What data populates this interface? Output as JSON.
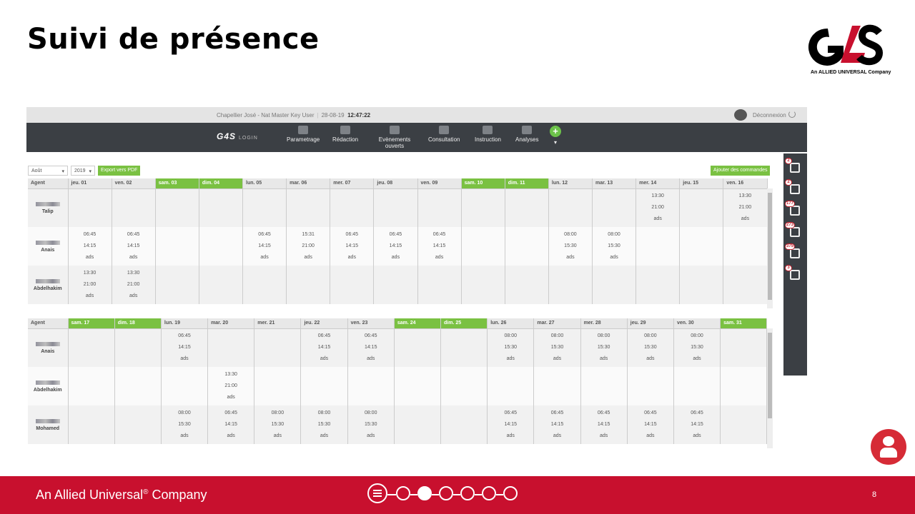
{
  "slide": {
    "title": "Suivi de présence",
    "page_number": "8"
  },
  "logo": {
    "text": "G4S",
    "tagline": "An ALLIED UNIVERSAL Company"
  },
  "app": {
    "topbar": {
      "user": "Chapellier José - Nat Master Key User",
      "date": "28-08-19",
      "time": "12:47:22",
      "logout": "Déconnexion"
    },
    "brand": {
      "mark": "G4S",
      "label": "LOGIN"
    },
    "nav": [
      {
        "label": "Parametrage",
        "icon": "gear-icon"
      },
      {
        "label": "Rédaction",
        "icon": "pencil-icon"
      },
      {
        "label": "Evènements ouverts",
        "icon": "clipboard-icon"
      },
      {
        "label": "Consultation",
        "icon": "book-icon"
      },
      {
        "label": "Instruction",
        "icon": "hierarchy-icon"
      },
      {
        "label": "Analyses",
        "icon": "bar-chart-icon"
      }
    ],
    "controls": {
      "month": "Août",
      "year": "2019",
      "export": "Export vers PDF",
      "add": "Ajouter des commandes"
    },
    "table1": {
      "headers": [
        "Agent",
        "jeu. 01",
        "ven. 02",
        "sam. 03",
        "dim. 04",
        "lun. 05",
        "mar. 06",
        "mer. 07",
        "jeu. 08",
        "ven. 09",
        "sam. 10",
        "dim. 11",
        "lun. 12",
        "mar. 13",
        "mer. 14",
        "jeu. 15",
        "ven. 16"
      ],
      "rows": [
        {
          "agent": "Talip",
          "cells": {
            "14": [
              "13:30",
              "21:00",
              "ads"
            ],
            "16": [
              "13:30",
              "21:00",
              "ads"
            ]
          }
        },
        {
          "agent": "Anais",
          "cells": {
            "1": [
              "06:45",
              "14:15",
              "ads"
            ],
            "2": [
              "06:45",
              "14:15",
              "ads"
            ],
            "5": [
              "06:45",
              "14:15",
              "ads"
            ],
            "6": [
              "15:31",
              "21:00",
              "ads"
            ],
            "7": [
              "06:45",
              "14:15",
              "ads"
            ],
            "8": [
              "06:45",
              "14:15",
              "ads"
            ],
            "9": [
              "06:45",
              "14:15",
              "ads"
            ],
            "12": [
              "08:00",
              "15:30",
              "ads"
            ],
            "13": [
              "08:00",
              "15:30",
              "ads"
            ]
          }
        },
        {
          "agent": "Abdelhakim",
          "cells": {
            "1": [
              "13:30",
              "21:00",
              "ads"
            ],
            "2": [
              "13:30",
              "21:00",
              "ads"
            ]
          }
        }
      ]
    },
    "table2": {
      "headers": [
        "Agent",
        "sam. 17",
        "dim. 18",
        "lun. 19",
        "mar. 20",
        "mer. 21",
        "jeu. 22",
        "ven. 23",
        "sam. 24",
        "dim. 25",
        "lun. 26",
        "mar. 27",
        "mer. 28",
        "jeu. 29",
        "ven. 30",
        "sam. 31"
      ],
      "rows": [
        {
          "agent": "Anais",
          "cells": {
            "3": [
              "06:45",
              "14:15",
              "ads"
            ],
            "6": [
              "06:45",
              "14:15",
              "ads"
            ],
            "7": [
              "06:45",
              "14:15",
              "ads"
            ],
            "10": [
              "08:00",
              "15:30",
              "ads"
            ],
            "11": [
              "08:00",
              "15:30",
              "ads"
            ],
            "12": [
              "08:00",
              "15:30",
              "ads"
            ],
            "13": [
              "08:00",
              "15:30",
              "ads"
            ],
            "14": [
              "08:00",
              "15:30",
              "ads"
            ]
          }
        },
        {
          "agent": "Abdelhakim",
          "cells": {
            "4": [
              "13:30",
              "21:00",
              "ads"
            ]
          }
        },
        {
          "agent": "Mohamed",
          "cells": {
            "3": [
              "08:00",
              "15:30",
              "ads"
            ],
            "4": [
              "06:45",
              "14:15",
              "ads"
            ],
            "5": [
              "08:00",
              "15:30",
              "ads"
            ],
            "6": [
              "08:00",
              "15:30",
              "ads"
            ],
            "7": [
              "08:00",
              "15:30",
              "ads"
            ],
            "10": [
              "06:45",
              "14:15",
              "ads"
            ],
            "11": [
              "06:45",
              "14:15",
              "ads"
            ],
            "12": [
              "06:45",
              "14:15",
              "ads"
            ],
            "13": [
              "06:45",
              "14:15",
              "ads"
            ],
            "14": [
              "06:45",
              "14:15",
              "ads"
            ]
          }
        }
      ]
    },
    "sidebar": [
      {
        "icon": "gears-icon",
        "badge": "2"
      },
      {
        "icon": "warning-icon",
        "badge": "2"
      },
      {
        "icon": "clipboard-icon",
        "badge": "177"
      },
      {
        "icon": "id-card-icon",
        "badge": "273"
      },
      {
        "icon": "chart-people-icon",
        "badge": "375"
      },
      {
        "icon": "org-chart-icon",
        "badge": "3"
      }
    ]
  },
  "footer": {
    "company": "An Allied Universal",
    "company_suffix": " Company",
    "reg": "®"
  },
  "colors": {
    "brand_red": "#c8102e",
    "weekend_green": "#7ac142",
    "nav_dark": "#3b3f44"
  }
}
